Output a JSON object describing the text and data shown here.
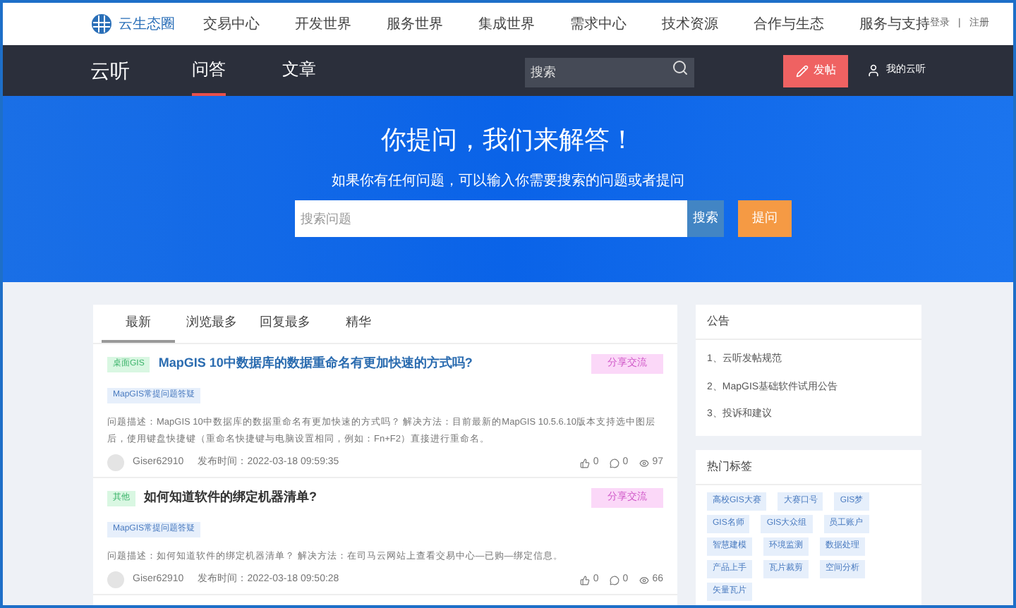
{
  "top_bar": {
    "logo_text": "云生态圈",
    "menu": [
      "交易中心",
      "开发世界",
      "服务世界",
      "集成世界",
      "需求中心",
      "技术资源",
      "合作与生态",
      "服务与支持"
    ],
    "login": "登录",
    "separator": "|",
    "register": "注册"
  },
  "nav": {
    "brand": "云听",
    "tabs": [
      {
        "label": "问答",
        "selected": true
      },
      {
        "label": "文章",
        "selected": false
      }
    ],
    "search": {
      "placeholder": "搜索"
    },
    "post_button": "发帖",
    "user": "我的云听"
  },
  "hero": {
    "title": "你提问，我们来解答！",
    "subtitle": "如果你有任何问题，可以输入你需要搜索的问题或者提问",
    "search": {
      "placeholder": "搜索问题"
    },
    "search_button": "搜索",
    "ask_button": "提问"
  },
  "feed": {
    "tabs": [
      {
        "label": "最新",
        "selected": true
      },
      {
        "label": "浏览最多",
        "selected": false
      },
      {
        "label": "回复最多",
        "selected": false
      },
      {
        "label": "精华",
        "selected": false
      }
    ],
    "posts": [
      {
        "tag": "桌面GIS",
        "title": "MapGIS 10中数据库的数据重命名有更加快速的方式吗?",
        "title_link": true,
        "category": "分享交流",
        "label": "MapGIS常提问题答疑",
        "description": "问题描述：MapGIS 10中数据库的数据重命名有更加快速的方式吗？ 解决方法：目前最新的MapGIS 10.5.6.10版本支持选中图层后，使用键盘快捷键（重命名快捷键与电脑设置相同，例如：Fn+F2）直接进行重命名。",
        "author": "Giser62910",
        "time": "发布时间：2022-03-18 09:59:35",
        "likes": "0",
        "comments": "0",
        "views": "97"
      },
      {
        "tag": "其他",
        "title": "如何知道软件的绑定机器清单?",
        "title_link": false,
        "category": "分享交流",
        "label": "MapGIS常提问题答疑",
        "description": "问题描述：如何知道软件的绑定机器清单？ 解决方法：在司马云网站上查看交易中心—已购—绑定信息。",
        "author": "Giser62910",
        "time": "发布时间：2022-03-18 09:50:28",
        "likes": "0",
        "comments": "0",
        "views": "66"
      }
    ]
  },
  "notice": {
    "title": "公告",
    "items": [
      "1、云听发帖规范",
      "2、MapGIS基础软件试用公告",
      "3、投诉和建议"
    ]
  },
  "hot_tags": {
    "title": "热门标签",
    "tags": [
      "高校GIS大赛",
      "大赛口号",
      "GIS梦",
      "GIS名师",
      "GIS大众组",
      "员工账户",
      "智慧建模",
      "环境监测",
      "数据处理",
      "产品上手",
      "瓦片裁剪",
      "空间分析",
      "矢量瓦片"
    ]
  }
}
